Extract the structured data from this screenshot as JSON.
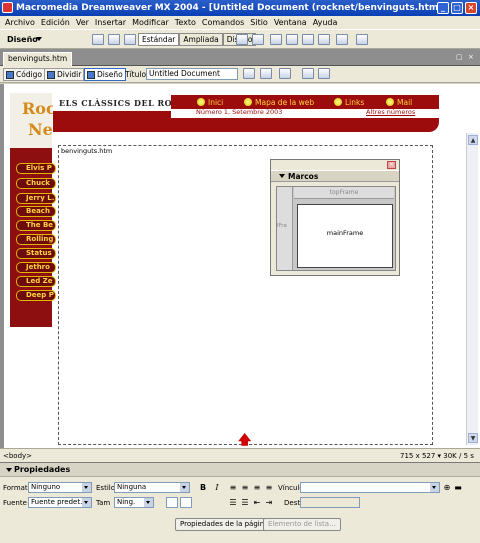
{
  "window": {
    "title": "Macromedia Dreamweaver MX 2004 - [Untitled Document (rocknet/benvinguts.htm)]"
  },
  "menu": [
    "Archivo",
    "Edición",
    "Ver",
    "Insertar",
    "Modificar",
    "Texto",
    "Comandos",
    "Sitio",
    "Ventana",
    "Ayuda"
  ],
  "toolbar": {
    "mode": "Diseño",
    "layout_tabs": [
      "Estándar",
      "Ampliada",
      "Diseño"
    ]
  },
  "document": {
    "tab": "benvinguts.htm"
  },
  "doc_toolbar": {
    "views": [
      "Código",
      "Dividir",
      "Diseño"
    ],
    "title_label": "Título:",
    "title_value": "Untitled Document"
  },
  "site": {
    "logo_line1": "Roc",
    "logo_line2": "Ne",
    "title": "ELS CLÀSSICS DEL ROCK",
    "nav": [
      "Inici",
      "Mapa de la web",
      "Links",
      "Mail"
    ],
    "issue": "Número 1, Setembre 2003",
    "prev": "Altres números",
    "sidebar": [
      "Elvis P",
      "Chuck",
      "Jerry L.",
      "Beach",
      "The Be",
      "Rolling",
      "Status",
      "Jethro",
      "Led Ze",
      "Deep P"
    ]
  },
  "frame_filename": "benvinguts.htm",
  "frames_panel": {
    "title": "Marcos",
    "top": "topFrame",
    "left": "lFra",
    "main": "mainFrame"
  },
  "status": {
    "tag": "<body>",
    "info": "715 x 527 ▾ 30K / 5 s"
  },
  "properties": {
    "title": "Propiedades",
    "format_label": "Formato",
    "format_value": "Ninguno",
    "style_label": "Estilo",
    "style_value": "Ninguna",
    "font_label": "Fuente",
    "font_value": "Fuente predet.",
    "size_label": "Tam",
    "size_value": "Ning.",
    "link_label": "Vínculo",
    "target_label": "Dest",
    "bold": "B",
    "italic": "I",
    "page_props_button": "Propiedades de la página...",
    "list_item_button": "Elemento de lista..."
  }
}
